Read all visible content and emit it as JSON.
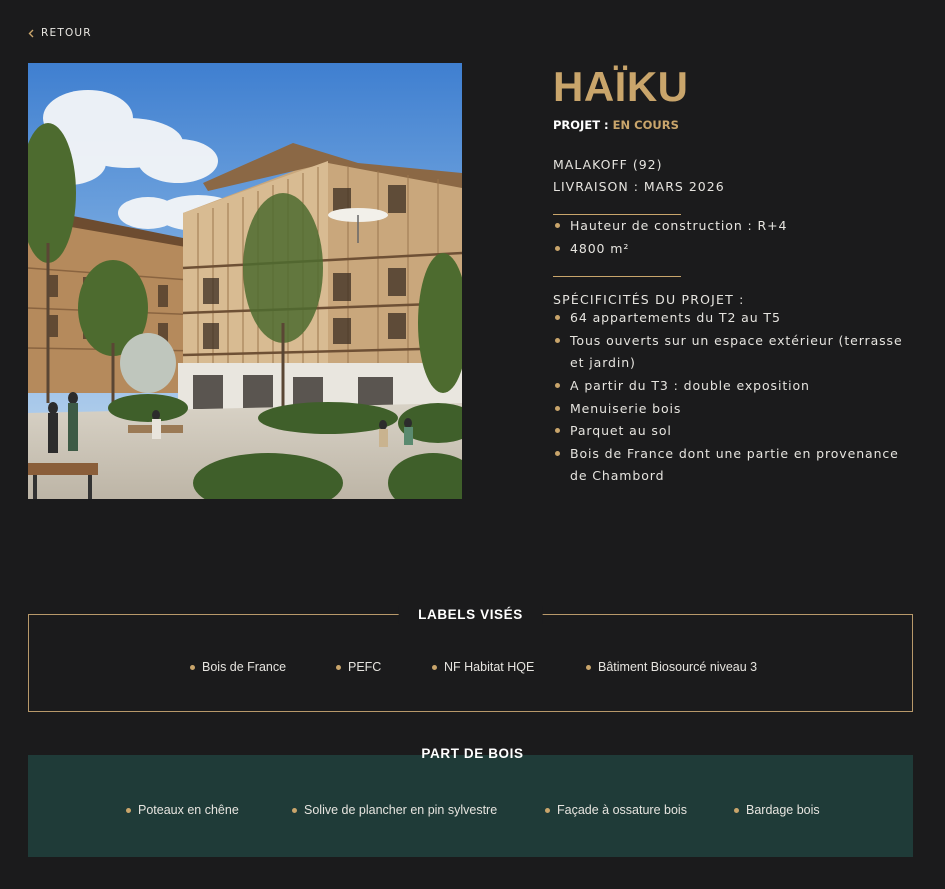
{
  "nav": {
    "back_label": "RETOUR",
    "back_icon": "chevron-left-icon"
  },
  "project": {
    "title": "HAÏKU",
    "status_label": "PROJET :",
    "status_value": "EN COURS",
    "location": "MALAKOFF (92)",
    "delivery": "LIVRAISON : MARS 2026",
    "highlights": [
      "Hauteur de construction : R+4",
      "4800 m²"
    ],
    "specs_heading": "SPÉCIFICITÉS DU PROJET :",
    "specs": [
      "64 appartements du T2 au T5",
      "Tous ouverts sur un espace extérieur (terrasse et jardin)",
      "A partir du T3 : double exposition",
      "Menuiserie bois",
      "Parquet au sol",
      "Bois de France dont une partie en provenance de Chambord"
    ]
  },
  "labels": {
    "title": "LABELS VISÉS",
    "items": [
      "Bois de France",
      "PEFC",
      "NF Habitat HQE",
      "Bâtiment Biosourcé niveau 3"
    ]
  },
  "wood": {
    "title": "PART DE BOIS",
    "items": [
      "Poteaux en chêne",
      "Solive de plancher en pin sylvestre",
      "Façade à ossature bois",
      "Bardage bois"
    ]
  },
  "colors": {
    "background": "#1b1b1c",
    "accent_gold": "#c9a56b",
    "wood_panel": "#1f3b38",
    "text": "#e6e4df"
  }
}
